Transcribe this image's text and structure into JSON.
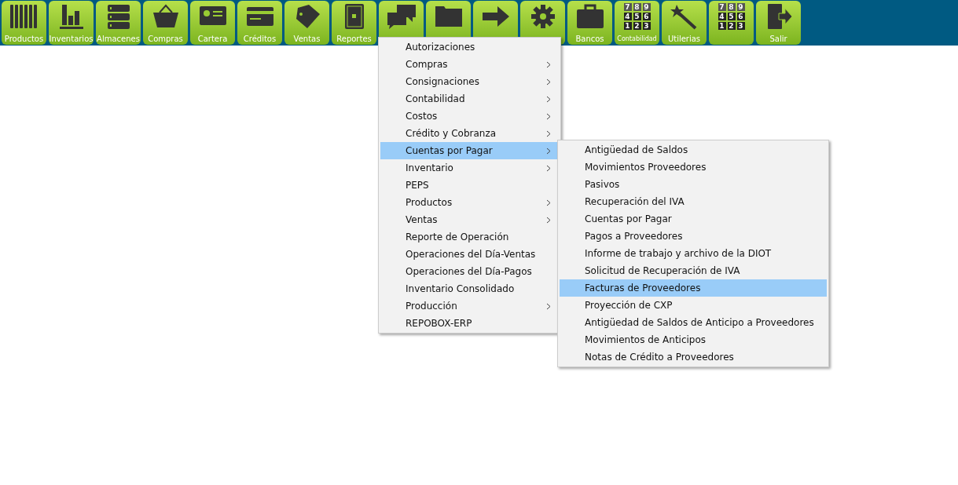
{
  "toolbar": [
    {
      "kind": "barcode",
      "label": "Productos"
    },
    {
      "kind": "chart",
      "label": "Inventarios"
    },
    {
      "kind": "storage",
      "label": "Almacenes"
    },
    {
      "kind": "basket",
      "label": "Compras"
    },
    {
      "kind": "idcard",
      "label": "Cartera"
    },
    {
      "kind": "card",
      "label": "Créditos"
    },
    {
      "kind": "tag",
      "label": "Ventas"
    },
    {
      "kind": "safe",
      "label": "Reportes"
    },
    {
      "kind": "chat"
    },
    {
      "kind": "folder"
    },
    {
      "kind": "arrow"
    },
    {
      "kind": "gear"
    },
    {
      "kind": "briefcase",
      "label": "Bancos"
    },
    {
      "kind": "keypad",
      "label": "Contabilidad",
      "keys": [
        "7",
        "8",
        "9",
        "4",
        "5",
        "6",
        "1",
        "2",
        "3"
      ]
    },
    {
      "kind": "wand",
      "label": "Utilerias"
    },
    {
      "kind": "keypad",
      "keys": [
        "7",
        "8",
        "9",
        "4",
        "5",
        "6",
        "1",
        "2",
        "3"
      ]
    },
    {
      "kind": "exit",
      "label": "Salir"
    }
  ],
  "menu": [
    {
      "label": "Autorizaciones",
      "submenu": false,
      "selected": false
    },
    {
      "label": "Compras",
      "submenu": true,
      "selected": false
    },
    {
      "label": "Consignaciones",
      "submenu": true,
      "selected": false
    },
    {
      "label": "Contabilidad",
      "submenu": true,
      "selected": false
    },
    {
      "label": "Costos",
      "submenu": true,
      "selected": false
    },
    {
      "label": "Crédito y Cobranza",
      "submenu": true,
      "selected": false
    },
    {
      "label": "Cuentas por Pagar",
      "submenu": true,
      "selected": true,
      "children": [
        {
          "label": "Antigüedad de Saldos",
          "selected": false
        },
        {
          "label": "Movimientos Proveedores",
          "selected": false
        },
        {
          "label": "Pasivos",
          "selected": false
        },
        {
          "label": "Recuperación del IVA",
          "selected": false
        },
        {
          "label": "Cuentas por Pagar",
          "selected": false
        },
        {
          "label": "Pagos a Proveedores",
          "selected": false
        },
        {
          "label": "Informe de trabajo y archivo de la DIOT",
          "selected": false
        },
        {
          "label": "Solicitud de Recuperación de IVA",
          "selected": false
        },
        {
          "label": "Facturas de Proveedores",
          "selected": true
        },
        {
          "label": "Proyección de CXP",
          "selected": false
        },
        {
          "label": "Antigüedad de Saldos de Anticipo a Proveedores",
          "selected": false
        },
        {
          "label": "Movimientos de Anticipos",
          "selected": false
        },
        {
          "label": "Notas de Crédito a Proveedores",
          "selected": false
        }
      ]
    },
    {
      "label": "Inventario",
      "submenu": true,
      "selected": false
    },
    {
      "label": "PEPS",
      "submenu": false,
      "selected": false
    },
    {
      "label": "Productos",
      "submenu": true,
      "selected": false
    },
    {
      "label": "Ventas",
      "submenu": true,
      "selected": false
    },
    {
      "label": "Reporte de Operación",
      "submenu": false,
      "selected": false
    },
    {
      "label": "Operaciones del Día-Ventas",
      "submenu": false,
      "selected": false
    },
    {
      "label": "Operaciones del Día-Pagos",
      "submenu": false,
      "selected": false
    },
    {
      "label": "Inventario Consolidado",
      "submenu": false,
      "selected": false
    },
    {
      "label": "Producción",
      "submenu": true,
      "selected": false
    },
    {
      "label": "REPOBOX-ERP",
      "submenu": false,
      "selected": false
    }
  ]
}
